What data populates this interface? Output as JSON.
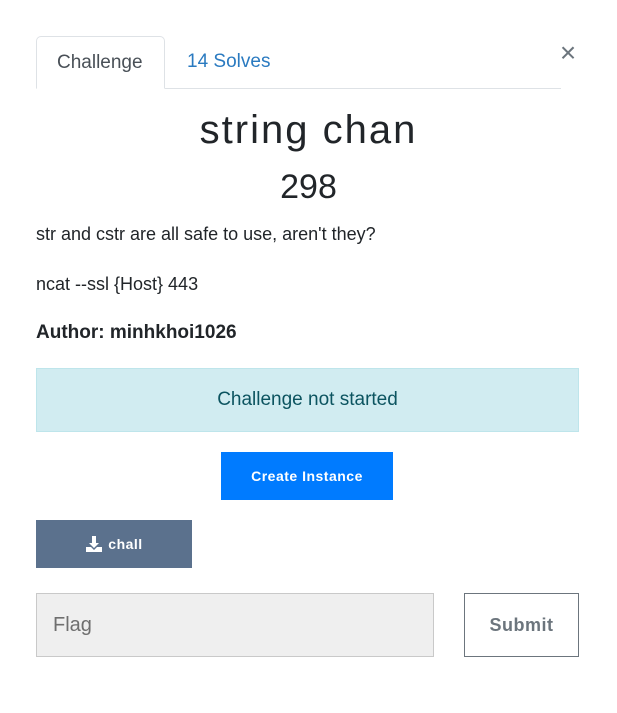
{
  "tabs": {
    "challenge_label": "Challenge",
    "solves_label": "14 Solves"
  },
  "close_label": "×",
  "challenge": {
    "name": "string chan",
    "points": "298",
    "description": [
      "str and cstr are all safe to use, aren't they?",
      "ncat --ssl {Host} 443",
      "Author: minhkhoi1026"
    ]
  },
  "status": {
    "text": "Challenge not started"
  },
  "actions": {
    "create_instance_label": "Create Instance"
  },
  "files": [
    {
      "name": "chall",
      "icon": "download-icon"
    }
  ],
  "submission": {
    "flag_placeholder": "Flag",
    "flag_value": "",
    "submit_label": "Submit"
  },
  "colors": {
    "link": "#2a7ac0",
    "alert_bg": "#d1ecf1",
    "alert_text": "#0c5460",
    "primary": "#007bff",
    "file_button": "#5b718d",
    "secondary": "#6c757d"
  }
}
